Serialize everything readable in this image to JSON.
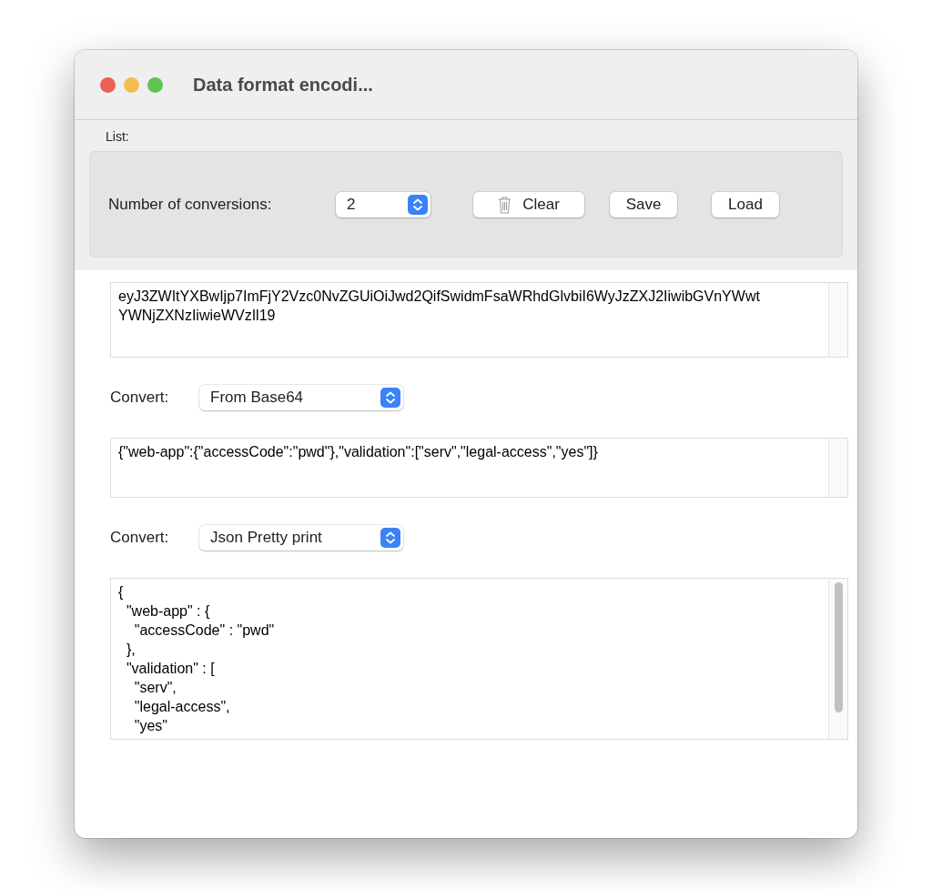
{
  "window": {
    "title": "Data format encodi..."
  },
  "list_group": {
    "label": "List:",
    "count_label": "Number of conversions:",
    "count_value": "2",
    "buttons": [
      {
        "kind": "trash",
        "label": "Clear"
      },
      {
        "kind": "plain",
        "label": "Save"
      },
      {
        "kind": "plain",
        "label": "Load"
      }
    ]
  },
  "input": {
    "lines": [
      "eyJ3ZWItYXBwIjp7ImFjY2Vzc0NvZGUiOiJwd2QifSwidmFsaWRhdGlvbiI6WyJzZXJ2IiwibGVnYWwt",
      "YWNjZXNzIiwieWVzIl19"
    ],
    "scrollable": false
  },
  "conversions": [
    {
      "label": "Convert:",
      "method": "From Base64",
      "output": {
        "lines": [
          "{\"web-app\":{\"accessCode\":\"pwd\"},\"validation\":[\"serv\",\"legal-access\",\"yes\"]}"
        ],
        "scrollable": false
      }
    },
    {
      "label": "Convert:",
      "method": "Json Pretty print",
      "output": {
        "lines": [
          "{",
          "  \"web-app\" : {",
          "    \"accessCode\" : \"pwd\"",
          "  },",
          "  \"validation\" : [",
          "    \"serv\",",
          "    \"legal-access\",",
          "    \"yes\""
        ],
        "scrollable": true
      }
    }
  ]
}
